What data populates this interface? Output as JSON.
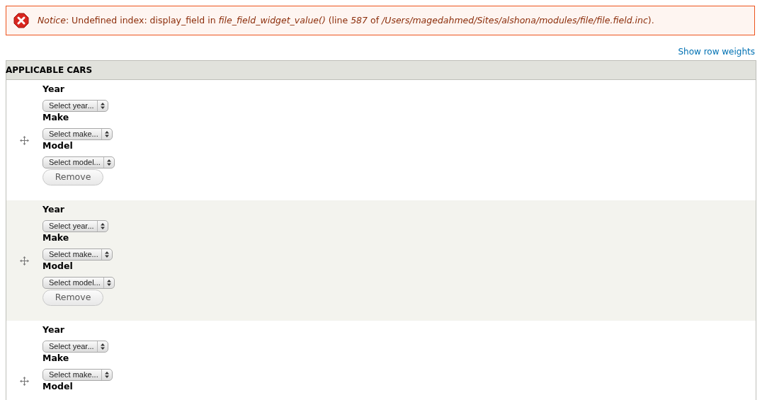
{
  "notice": {
    "message": "*Notice*: Undefined index: display_field in *file_field_widget_value()* (line *587* of */Users/magedahmed/Sites/alshona/modules/file/file.field.inc*)."
  },
  "row_weights_link": "Show row weights",
  "table": {
    "heading": "APPLICABLE CARS",
    "rows": [
      {
        "fields": [
          {
            "label": "Year",
            "placeholder": "Select year..."
          },
          {
            "label": "Make",
            "placeholder": "Select make..."
          },
          {
            "label": "Model",
            "placeholder": "Select model..."
          }
        ],
        "remove": "Remove"
      },
      {
        "fields": [
          {
            "label": "Year",
            "placeholder": "Select year..."
          },
          {
            "label": "Make",
            "placeholder": "Select make..."
          },
          {
            "label": "Model",
            "placeholder": "Select model..."
          }
        ],
        "remove": "Remove"
      },
      {
        "fields": [
          {
            "label": "Year",
            "placeholder": "Select year..."
          },
          {
            "label": "Make",
            "placeholder": "Select make..."
          },
          {
            "label": "Model"
          }
        ]
      }
    ]
  }
}
